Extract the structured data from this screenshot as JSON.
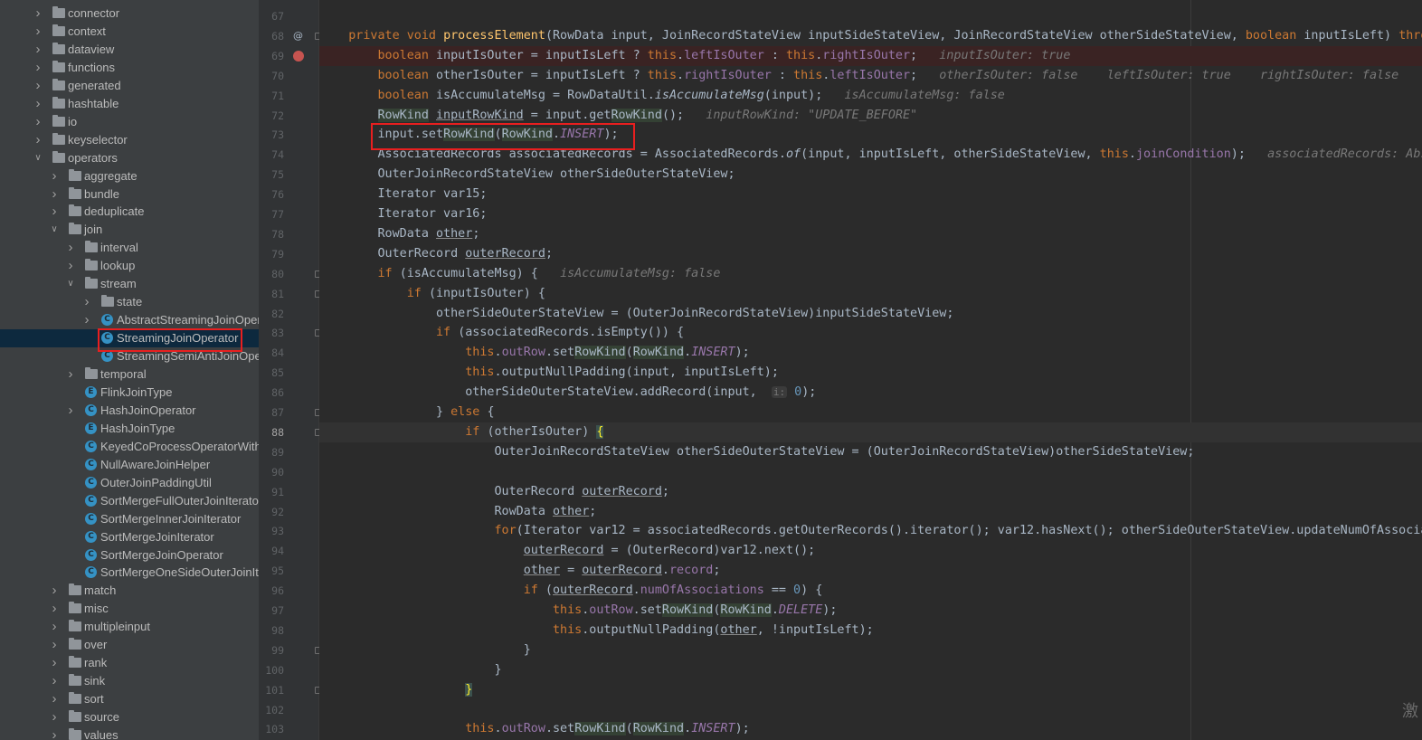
{
  "tree": {
    "items": [
      {
        "label": "connector",
        "kind": "folder",
        "depth": 0,
        "arrow": "right"
      },
      {
        "label": "context",
        "kind": "folder",
        "depth": 0,
        "arrow": "right"
      },
      {
        "label": "dataview",
        "kind": "folder",
        "depth": 0,
        "arrow": "right"
      },
      {
        "label": "functions",
        "kind": "folder",
        "depth": 0,
        "arrow": "right"
      },
      {
        "label": "generated",
        "kind": "folder",
        "depth": 0,
        "arrow": "right"
      },
      {
        "label": "hashtable",
        "kind": "folder",
        "depth": 0,
        "arrow": "right"
      },
      {
        "label": "io",
        "kind": "folder",
        "depth": 0,
        "arrow": "right"
      },
      {
        "label": "keyselector",
        "kind": "folder",
        "depth": 0,
        "arrow": "right"
      },
      {
        "label": "operators",
        "kind": "folder",
        "depth": 0,
        "arrow": "down"
      },
      {
        "label": "aggregate",
        "kind": "folder",
        "depth": 1,
        "arrow": "right"
      },
      {
        "label": "bundle",
        "kind": "folder",
        "depth": 1,
        "arrow": "right"
      },
      {
        "label": "deduplicate",
        "kind": "folder",
        "depth": 1,
        "arrow": "right"
      },
      {
        "label": "join",
        "kind": "folder",
        "depth": 1,
        "arrow": "down"
      },
      {
        "label": "interval",
        "kind": "folder",
        "depth": 2,
        "arrow": "right"
      },
      {
        "label": "lookup",
        "kind": "folder",
        "depth": 2,
        "arrow": "right"
      },
      {
        "label": "stream",
        "kind": "folder",
        "depth": 2,
        "arrow": "down"
      },
      {
        "label": "state",
        "kind": "folder",
        "depth": 3,
        "arrow": "right"
      },
      {
        "label": "AbstractStreamingJoinOper",
        "kind": "class",
        "depth": 3,
        "arrow": "right"
      },
      {
        "label": "StreamingJoinOperator",
        "kind": "class",
        "depth": 3,
        "arrow": "none",
        "selected": true
      },
      {
        "label": "StreamingSemiAntiJoinOpe",
        "kind": "class",
        "depth": 3,
        "arrow": "none"
      },
      {
        "label": "temporal",
        "kind": "folder",
        "depth": 2,
        "arrow": "right"
      },
      {
        "label": "FlinkJoinType",
        "kind": "enum",
        "depth": 2,
        "arrow": "none"
      },
      {
        "label": "HashJoinOperator",
        "kind": "class",
        "depth": 2,
        "arrow": "right"
      },
      {
        "label": "HashJoinType",
        "kind": "enum",
        "depth": 2,
        "arrow": "none"
      },
      {
        "label": "KeyedCoProcessOperatorWith",
        "kind": "class",
        "depth": 2,
        "arrow": "none"
      },
      {
        "label": "NullAwareJoinHelper",
        "kind": "class",
        "depth": 2,
        "arrow": "none"
      },
      {
        "label": "OuterJoinPaddingUtil",
        "kind": "class",
        "depth": 2,
        "arrow": "none"
      },
      {
        "label": "SortMergeFullOuterJoinIterato",
        "kind": "class",
        "depth": 2,
        "arrow": "none"
      },
      {
        "label": "SortMergeInnerJoinIterator",
        "kind": "class",
        "depth": 2,
        "arrow": "none"
      },
      {
        "label": "SortMergeJoinIterator",
        "kind": "class",
        "depth": 2,
        "arrow": "none"
      },
      {
        "label": "SortMergeJoinOperator",
        "kind": "class",
        "depth": 2,
        "arrow": "none"
      },
      {
        "label": "SortMergeOneSideOuterJoinIt",
        "kind": "class",
        "depth": 2,
        "arrow": "none"
      },
      {
        "label": "match",
        "kind": "folder",
        "depth": 1,
        "arrow": "right"
      },
      {
        "label": "misc",
        "kind": "folder",
        "depth": 1,
        "arrow": "right"
      },
      {
        "label": "multipleinput",
        "kind": "folder",
        "depth": 1,
        "arrow": "right"
      },
      {
        "label": "over",
        "kind": "folder",
        "depth": 1,
        "arrow": "right"
      },
      {
        "label": "rank",
        "kind": "folder",
        "depth": 1,
        "arrow": "right"
      },
      {
        "label": "sink",
        "kind": "folder",
        "depth": 1,
        "arrow": "right"
      },
      {
        "label": "sort",
        "kind": "folder",
        "depth": 1,
        "arrow": "right"
      },
      {
        "label": "source",
        "kind": "folder",
        "depth": 1,
        "arrow": "right"
      },
      {
        "label": "values",
        "kind": "folder",
        "depth": 1,
        "arrow": "right"
      }
    ]
  },
  "editor": {
    "current_line": 88,
    "breakpoint_line": 69,
    "lines": [
      {
        "no": "67",
        "html": ""
      },
      {
        "no": "68",
        "html": "    <span class=\"kw\">private void </span><span class=\"fn\">processElement</span>(RowData input, JoinRecordStateView inputSideStateView, JoinRecordStateView otherSideStateView, <span class=\"kw\">boolean </span>inputIsLeft) <span class=\"kw\">throws</span>"
      },
      {
        "no": "69",
        "html": "        <span class=\"kw\">boolean </span>inputIsOuter = inputIsLeft ? <span class=\"kw\">this</span>.<span class=\"field\">leftIsOuter</span> : <span class=\"kw\">this</span>.<span class=\"field\">rightIsOuter</span>;   <span class=\"hint\">inputIsOuter: true</span>"
      },
      {
        "no": "70",
        "html": "        <span class=\"kw\">boolean </span>otherIsOuter = inputIsLeft ? <span class=\"kw\">this</span>.<span class=\"field\">rightIsOuter</span> : <span class=\"kw\">this</span>.<span class=\"field\">leftIsOuter</span>;   <span class=\"hint\">otherIsOuter: false    leftIsOuter: true    rightIsOuter: false</span>"
      },
      {
        "no": "71",
        "html": "        <span class=\"kw\">boolean </span>isAccumulateMsg = RowDataUtil.<span class=\"italic\">isAccumulateMsg</span>(input);   <span class=\"hint\">isAccumulateMsg: false</span>"
      },
      {
        "no": "72",
        "html": "        <span class=\"hl\">RowKind</span> <span class=\"ul\">inputRowKind</span> = input.get<span class=\"hl\">RowKind</span>();   <span class=\"hint\">inputRowKind: \"UPDATE_BEFORE\"</span>"
      },
      {
        "no": "73",
        "html": "        input.set<span class=\"hl\">RowKind</span>(<span class=\"hl\">RowKind</span>.<span class=\"static\">INSERT</span>);"
      },
      {
        "no": "74",
        "html": "        AssociatedRecords associatedRecords = AssociatedRecords.<span class=\"italic\">of</span>(input, inputIsLeft, otherSideStateView, <span class=\"kw\">this</span>.<span class=\"field\">joinCondition</span>);   <span class=\"hint\">associatedRecords: Abs</span>"
      },
      {
        "no": "75",
        "html": "        OuterJoinRecordStateView otherSideOuterStateView;"
      },
      {
        "no": "76",
        "html": "        Iterator var15;"
      },
      {
        "no": "77",
        "html": "        Iterator var16;"
      },
      {
        "no": "78",
        "html": "        RowData <span class=\"ul\">other</span>;"
      },
      {
        "no": "79",
        "html": "        OuterRecord <span class=\"ul\">outerRecord</span>;"
      },
      {
        "no": "80",
        "html": "        <span class=\"kw\">if </span>(isAccumulateMsg) {   <span class=\"hint\">isAccumulateMsg: false</span>"
      },
      {
        "no": "81",
        "html": "            <span class=\"kw\">if </span>(inputIsOuter) {"
      },
      {
        "no": "82",
        "html": "                otherSideOuterStateView = (OuterJoinRecordStateView)inputSideStateView;"
      },
      {
        "no": "83",
        "html": "                <span class=\"kw\">if </span>(associatedRecords.isEmpty()) {"
      },
      {
        "no": "84",
        "html": "                    <span class=\"kw\">this</span>.<span class=\"field\">outRow</span>.set<span class=\"hl\">RowKind</span>(<span class=\"hl\">RowKind</span>.<span class=\"static\">INSERT</span>);"
      },
      {
        "no": "85",
        "html": "                    <span class=\"kw\">this</span>.outputNullPadding(input, inputIsLeft);"
      },
      {
        "no": "86",
        "html": "                    otherSideOuterStateView.addRecord(input,  <span class=\"param-hint\">i:</span> <span class=\"num\">0</span>);"
      },
      {
        "no": "87",
        "html": "                } <span class=\"kw\">else </span>{"
      },
      {
        "no": "88",
        "html": "                    <span class=\"kw\">if </span>(otherIsOuter) <span class=\"brace-hl\">{</span>"
      },
      {
        "no": "89",
        "html": "                        OuterJoinRecordStateView otherSideOuterStateView = (OuterJoinRecordStateView)otherSideStateView;"
      },
      {
        "no": "90",
        "html": ""
      },
      {
        "no": "91",
        "html": "                        OuterRecord <span class=\"ul\">outerRecord</span>;"
      },
      {
        "no": "92",
        "html": "                        RowData <span class=\"ul\">other</span>;"
      },
      {
        "no": "93",
        "html": "                        <span class=\"kw\">for</span>(Iterator var12 = associatedRecords.getOuterRecords().iterator(); var12.hasNext(); otherSideOuterStateView.updateNumOfAssocia"
      },
      {
        "no": "94",
        "html": "                            <span class=\"ul\">outerRecord</span> = (OuterRecord)var12.next();"
      },
      {
        "no": "95",
        "html": "                            <span class=\"ul\">other</span> = <span class=\"ul\">outerRecord</span>.<span class=\"field\">record</span>;"
      },
      {
        "no": "96",
        "html": "                            <span class=\"kw\">if </span>(<span class=\"ul\">outerRecord</span>.<span class=\"field\">numOfAssociations</span> == <span class=\"num\">0</span>) {"
      },
      {
        "no": "97",
        "html": "                                <span class=\"kw\">this</span>.<span class=\"field\">outRow</span>.set<span class=\"hl\">RowKind</span>(<span class=\"hl\">RowKind</span>.<span class=\"static\">DELETE</span>);"
      },
      {
        "no": "98",
        "html": "                                <span class=\"kw\">this</span>.outputNullPadding(<span class=\"ul\">other</span>, !inputIsLeft);"
      },
      {
        "no": "99",
        "html": "                            }"
      },
      {
        "no": "100",
        "html": "                        }"
      },
      {
        "no": "101",
        "html": "                    <span class=\"brace-hl\">}</span>"
      },
      {
        "no": "102",
        "html": ""
      },
      {
        "no": "103",
        "html": "                    <span class=\"kw\">this</span>.<span class=\"field\">outRow</span>.set<span class=\"hl\">RowKind</span>(<span class=\"hl\">RowKind</span>.<span class=\"static\">INSERT</span>);"
      }
    ]
  },
  "watermark": {
    "text": "激"
  },
  "colors": {
    "highlight_box": "#e81f1f",
    "breakpoint": "#c75450",
    "selection": "#0d293e"
  }
}
